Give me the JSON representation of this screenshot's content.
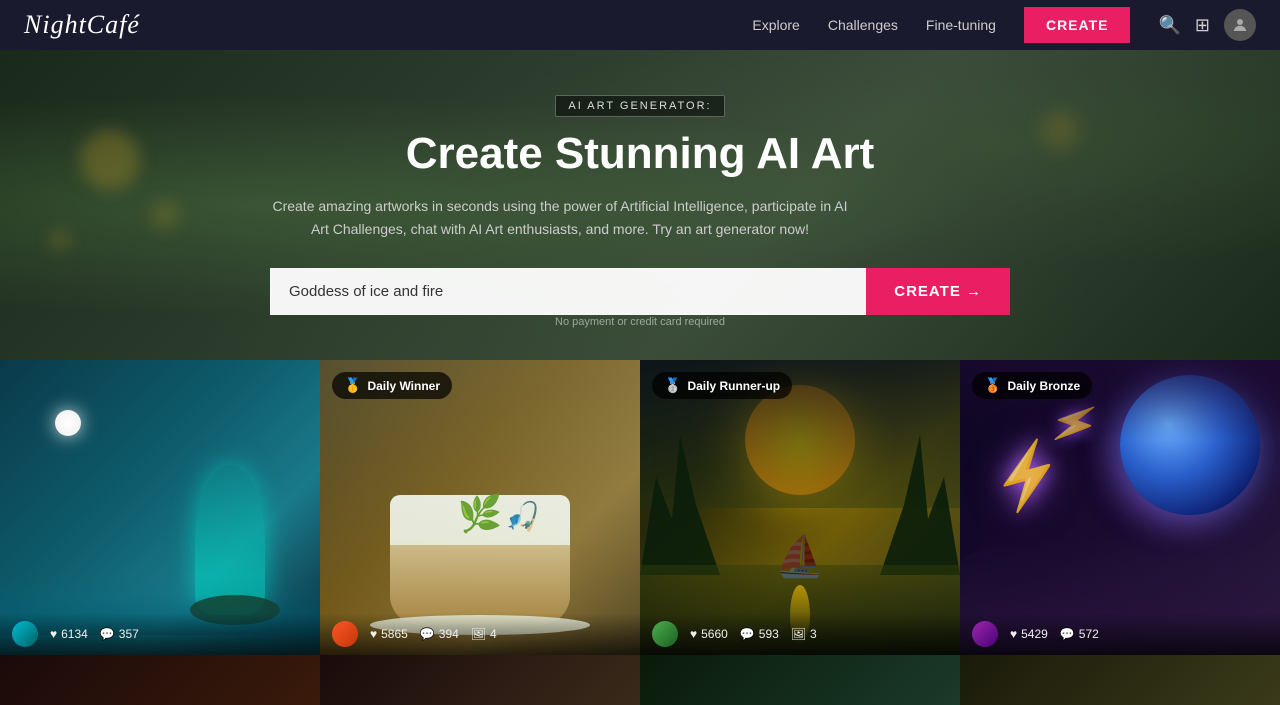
{
  "nav": {
    "logo": "NightCafé",
    "links": [
      {
        "label": "Explore",
        "id": "explore"
      },
      {
        "label": "Challenges",
        "id": "challenges"
      },
      {
        "label": "Fine-tuning",
        "id": "finetuning"
      }
    ],
    "create_label": "CREATE"
  },
  "hero": {
    "badge_label": "AI ART GENERATOR:",
    "title": "Create Stunning AI Art",
    "subtitle": "Create amazing artworks in seconds using the power of Artificial Intelligence, participate in AI Art Challenges, chat with AI Art enthusiasts, and more. Try an art generator now!",
    "input_value": "Goddess of ice and fire",
    "input_placeholder": "Goddess of ice and fire",
    "create_btn": "CREATE →",
    "note": "No payment or credit card required"
  },
  "gallery": {
    "items": [
      {
        "id": "item1",
        "badge": null,
        "stats": {
          "likes": "6134",
          "comments": "357",
          "images": null
        }
      },
      {
        "id": "item2",
        "badge": {
          "emoji": "🥇",
          "label": "Daily Winner"
        },
        "stats": {
          "likes": "5865",
          "comments": "394",
          "images": "4"
        }
      },
      {
        "id": "item3",
        "badge": {
          "emoji": "🥈",
          "label": "Daily Runner-up"
        },
        "stats": {
          "likes": "5660",
          "comments": "593",
          "images": "3"
        }
      },
      {
        "id": "item4",
        "badge": {
          "emoji": "🥉",
          "label": "Daily Bronze"
        },
        "stats": {
          "likes": "5429",
          "comments": "572",
          "images": null
        }
      }
    ]
  },
  "icons": {
    "search": "🔍",
    "grid": "⊞",
    "heart": "♥",
    "comment": "💬",
    "image": "🖼"
  }
}
